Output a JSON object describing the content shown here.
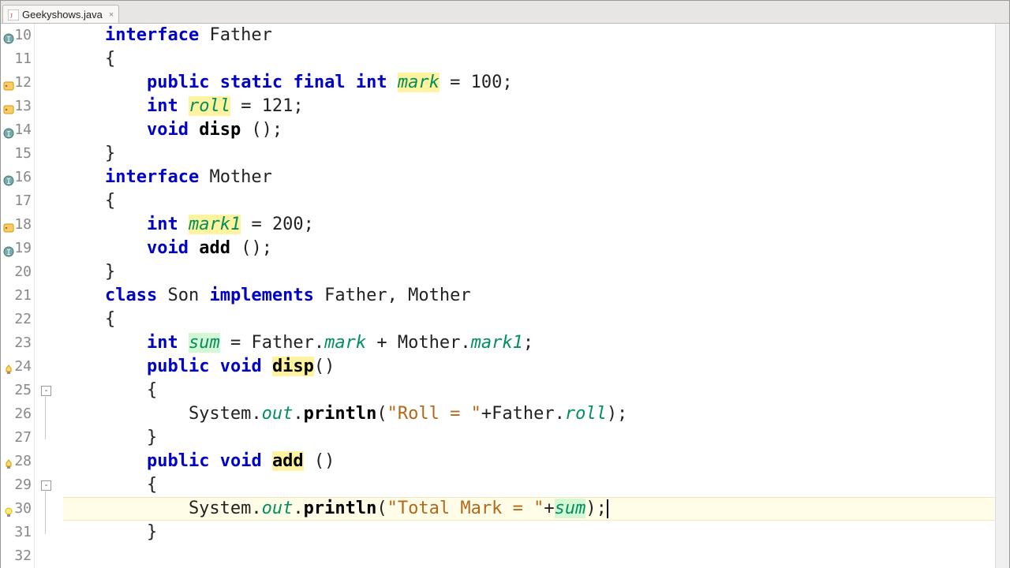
{
  "tab": {
    "filename": "Geekyshows.java",
    "close": "×"
  },
  "gutter": {
    "start": 10,
    "end": 32
  },
  "code": {
    "lines": [
      {
        "indent": 1,
        "tokens": [
          {
            "t": "interface",
            "c": "kw"
          },
          {
            "t": " Father"
          }
        ]
      },
      {
        "indent": 1,
        "tokens": [
          {
            "t": "{"
          }
        ]
      },
      {
        "indent": 2,
        "tokens": [
          {
            "t": "public",
            "c": "kw"
          },
          {
            "t": " "
          },
          {
            "t": "static",
            "c": "kw"
          },
          {
            "t": " "
          },
          {
            "t": "final",
            "c": "kw"
          },
          {
            "t": " "
          },
          {
            "t": "int",
            "c": "kw"
          },
          {
            "t": " "
          },
          {
            "t": "mark",
            "c": "field hl-yellow"
          },
          {
            "t": " = 100;"
          }
        ]
      },
      {
        "indent": 2,
        "tokens": [
          {
            "t": "int",
            "c": "kw"
          },
          {
            "t": " "
          },
          {
            "t": "roll",
            "c": "field hl-yellow"
          },
          {
            "t": " = 121;"
          }
        ]
      },
      {
        "indent": 2,
        "tokens": [
          {
            "t": "void",
            "c": "kw"
          },
          {
            "t": " "
          },
          {
            "t": "disp",
            "c": "method"
          },
          {
            "t": " ();"
          }
        ]
      },
      {
        "indent": 1,
        "tokens": [
          {
            "t": "}"
          }
        ]
      },
      {
        "indent": 1,
        "tokens": [
          {
            "t": "interface",
            "c": "kw"
          },
          {
            "t": " Mother"
          }
        ]
      },
      {
        "indent": 1,
        "tokens": [
          {
            "t": "{"
          }
        ]
      },
      {
        "indent": 2,
        "tokens": [
          {
            "t": "int",
            "c": "kw"
          },
          {
            "t": " "
          },
          {
            "t": "mark1",
            "c": "field hl-yellow"
          },
          {
            "t": " = 200;"
          }
        ]
      },
      {
        "indent": 2,
        "tokens": [
          {
            "t": "void",
            "c": "kw"
          },
          {
            "t": " "
          },
          {
            "t": "add",
            "c": "method"
          },
          {
            "t": " ();"
          }
        ]
      },
      {
        "indent": 1,
        "tokens": [
          {
            "t": "}"
          }
        ]
      },
      {
        "indent": 1,
        "tokens": [
          {
            "t": "class",
            "c": "kw"
          },
          {
            "t": " Son "
          },
          {
            "t": "implements",
            "c": "kw"
          },
          {
            "t": " Father, Mother"
          }
        ]
      },
      {
        "indent": 1,
        "tokens": [
          {
            "t": "{"
          }
        ]
      },
      {
        "indent": 2,
        "tokens": [
          {
            "t": "int",
            "c": "kw"
          },
          {
            "t": " "
          },
          {
            "t": "sum",
            "c": "field hl-green"
          },
          {
            "t": " = Father."
          },
          {
            "t": "mark",
            "c": "field"
          },
          {
            "t": " + Mother."
          },
          {
            "t": "mark1",
            "c": "field"
          },
          {
            "t": ";"
          }
        ]
      },
      {
        "indent": 2,
        "tokens": [
          {
            "t": "public",
            "c": "kw"
          },
          {
            "t": " "
          },
          {
            "t": "void",
            "c": "kw"
          },
          {
            "t": " "
          },
          {
            "t": "disp",
            "c": "method hl-yellow"
          },
          {
            "t": "()"
          }
        ]
      },
      {
        "indent": 2,
        "tokens": [
          {
            "t": "{"
          }
        ]
      },
      {
        "indent": 3,
        "tokens": [
          {
            "t": "System."
          },
          {
            "t": "out",
            "c": "field"
          },
          {
            "t": "."
          },
          {
            "t": "println",
            "c": "method"
          },
          {
            "t": "("
          },
          {
            "t": "\"Roll = \"",
            "c": "str"
          },
          {
            "t": "+Father."
          },
          {
            "t": "roll",
            "c": "field"
          },
          {
            "t": ");"
          }
        ]
      },
      {
        "indent": 2,
        "tokens": [
          {
            "t": "}"
          }
        ]
      },
      {
        "indent": 2,
        "tokens": [
          {
            "t": "public",
            "c": "kw"
          },
          {
            "t": " "
          },
          {
            "t": "void",
            "c": "kw"
          },
          {
            "t": " "
          },
          {
            "t": "add",
            "c": "method hl-yellow"
          },
          {
            "t": " ()"
          }
        ]
      },
      {
        "indent": 2,
        "tokens": [
          {
            "t": "{"
          }
        ]
      },
      {
        "indent": 3,
        "current": true,
        "tokens": [
          {
            "t": "System."
          },
          {
            "t": "out",
            "c": "field"
          },
          {
            "t": "."
          },
          {
            "t": "println",
            "c": "method"
          },
          {
            "t": "("
          },
          {
            "t": "\"Total Mark = \"",
            "c": "str"
          },
          {
            "t": "+"
          },
          {
            "t": "sum",
            "c": "field hl-green"
          },
          {
            "t": ");"
          }
        ],
        "cursor": true
      },
      {
        "indent": 2,
        "tokens": [
          {
            "t": "}"
          }
        ]
      },
      {
        "indent": 0,
        "tokens": []
      }
    ]
  },
  "markers": [
    {
      "line": 10,
      "type": "interface"
    },
    {
      "line": 12,
      "type": "warning"
    },
    {
      "line": 13,
      "type": "warning"
    },
    {
      "line": 14,
      "type": "interface"
    },
    {
      "line": 16,
      "type": "interface"
    },
    {
      "line": 18,
      "type": "warning"
    },
    {
      "line": 19,
      "type": "interface"
    },
    {
      "line": 24,
      "type": "hint"
    },
    {
      "line": 28,
      "type": "hint"
    },
    {
      "line": 30,
      "type": "bulb"
    }
  ],
  "folds": [
    {
      "line": 25,
      "span": 2
    },
    {
      "line": 29,
      "span": 2
    }
  ]
}
